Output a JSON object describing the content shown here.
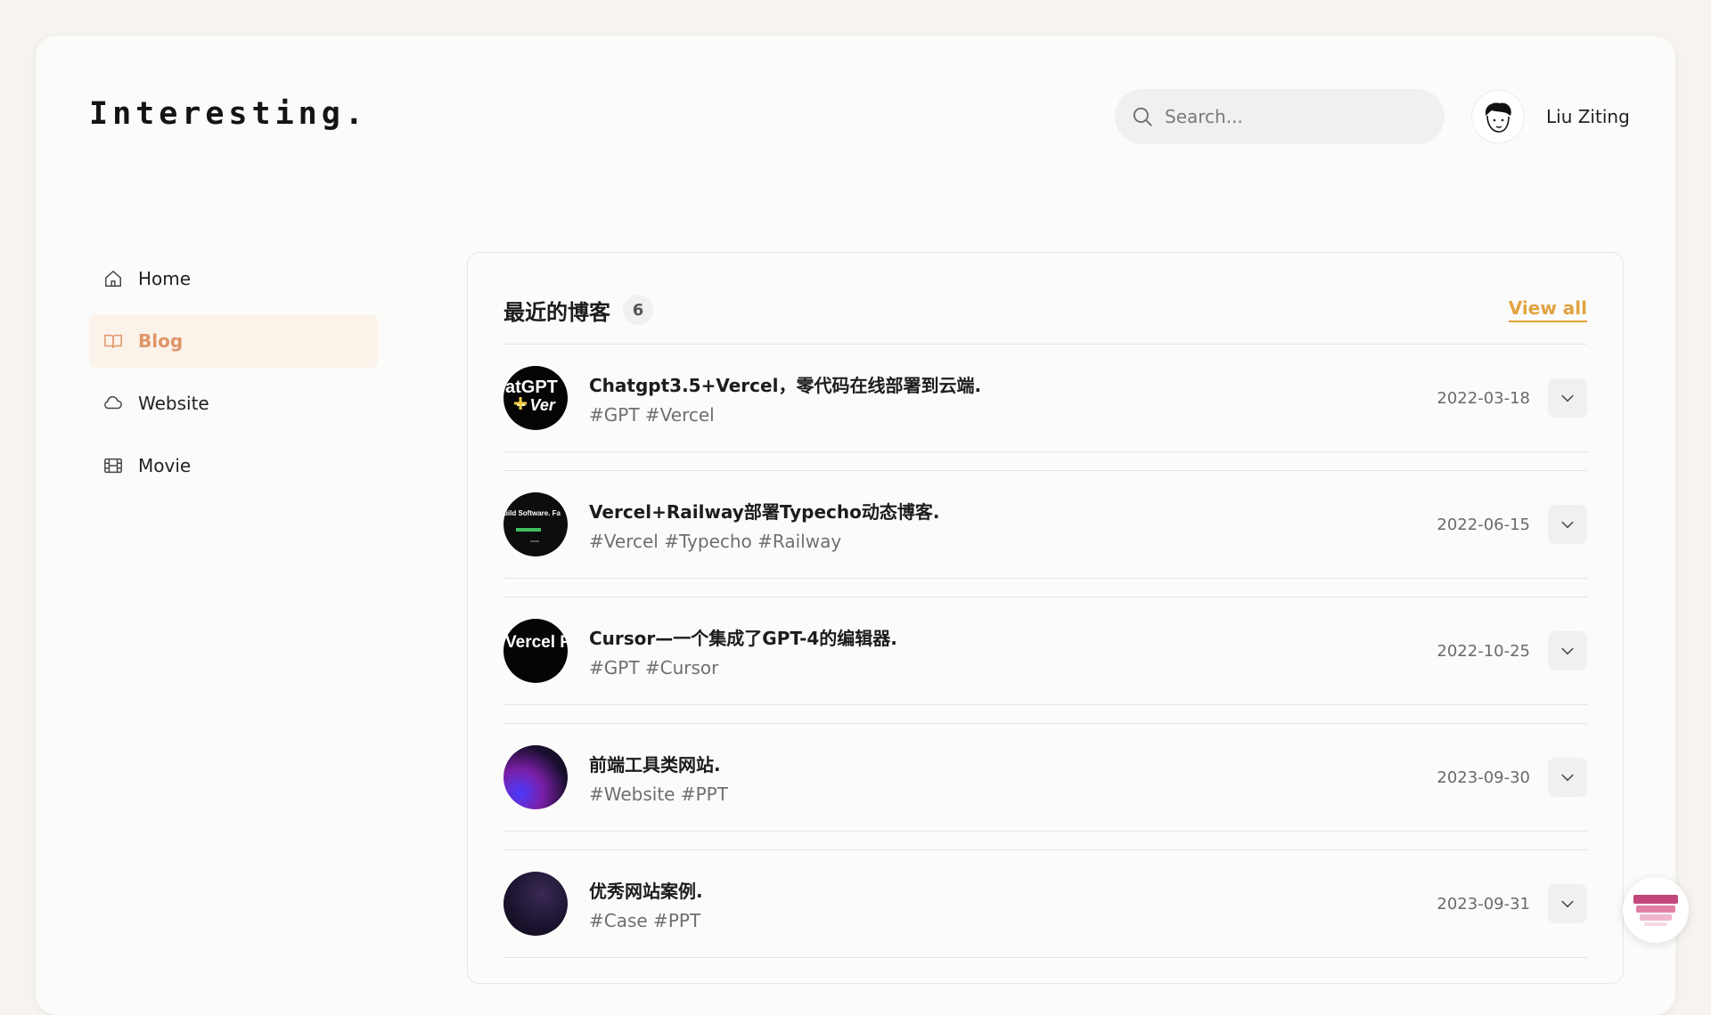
{
  "brand": {
    "logo_text": "Interesting."
  },
  "search": {
    "placeholder": "Search..."
  },
  "user": {
    "name": "Liu Ziting"
  },
  "nav": {
    "items": [
      {
        "label": "Home",
        "icon": "home-icon",
        "active": false
      },
      {
        "label": "Blog",
        "icon": "book-icon",
        "active": true
      },
      {
        "label": "Website",
        "icon": "cloud-icon",
        "active": false
      },
      {
        "label": "Movie",
        "icon": "film-icon",
        "active": false
      }
    ]
  },
  "recent": {
    "title": "最近的博客",
    "count": "6",
    "view_all": "View all",
    "posts": [
      {
        "title": "Chatgpt3.5+Vercel，零代码在线部署到云端.",
        "tags": "#GPT #Vercel",
        "date": "2022-03-18",
        "thumb_text": "atGPT"
      },
      {
        "title": "Vercel+Railway部署Typecho动态博客.",
        "tags": "#Vercel #Typecho #Railway",
        "date": "2022-06-15",
        "thumb_text": "uild Software. Fa"
      },
      {
        "title": "Cursor—一个集成了GPT-4的编辑器.",
        "tags": "#GPT #Cursor",
        "date": "2022-10-25",
        "thumb_text": "Vercel Railwa"
      },
      {
        "title": "前端工具类网站.",
        "tags": "#Website #PPT",
        "date": "2023-09-30",
        "thumb_text": ""
      },
      {
        "title": "优秀网站案例.",
        "tags": "#Case #PPT",
        "date": "2023-09-31",
        "thumb_text": ""
      }
    ]
  },
  "colors": {
    "accent_orange": "#e09567",
    "link_gold": "#e0a33f",
    "page_bg": "#f7f4ef"
  }
}
